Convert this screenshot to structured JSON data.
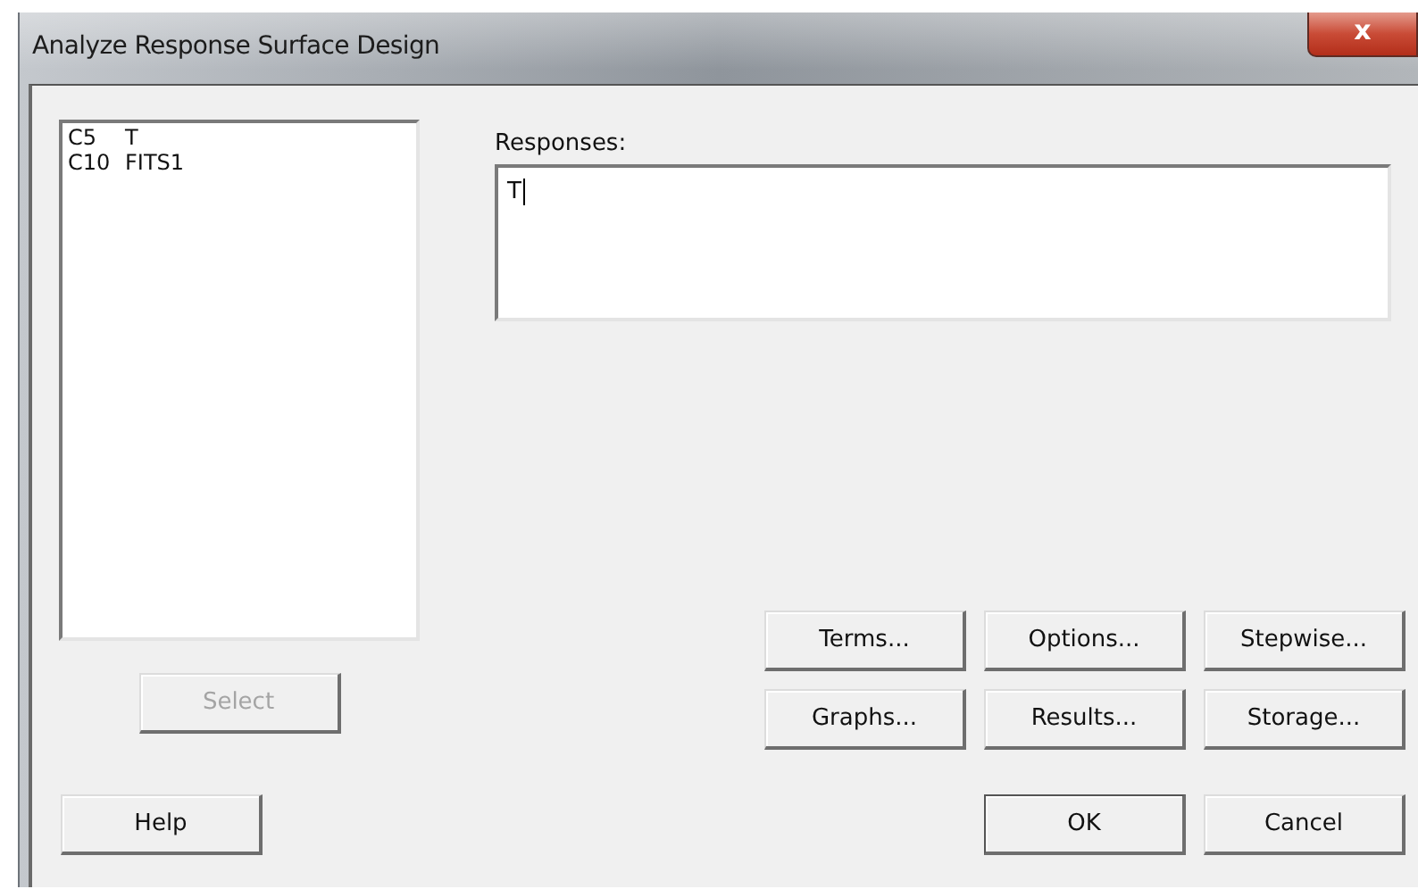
{
  "window": {
    "title": "Analyze Response Surface Design",
    "close_label": "x"
  },
  "variables": [
    {
      "column": "C5",
      "name": "T"
    },
    {
      "column": "C10",
      "name": "FITS1"
    }
  ],
  "select_button": {
    "label": "Select",
    "disabled": true
  },
  "responses": {
    "label": "Responses:",
    "value": "T"
  },
  "action_buttons": [
    {
      "label": "Terms...",
      "disabled": false
    },
    {
      "label": "Options...",
      "disabled": false
    },
    {
      "label": "Stepwise...",
      "disabled": false
    },
    {
      "label": "Graphs...",
      "disabled": false
    },
    {
      "label": "Results...",
      "disabled": false
    },
    {
      "label": "Storage...",
      "disabled": false
    }
  ],
  "help_button": {
    "label": "Help",
    "disabled": false
  },
  "dialog_buttons": [
    {
      "label": "OK",
      "default": true
    },
    {
      "label": "Cancel",
      "default": false
    }
  ]
}
